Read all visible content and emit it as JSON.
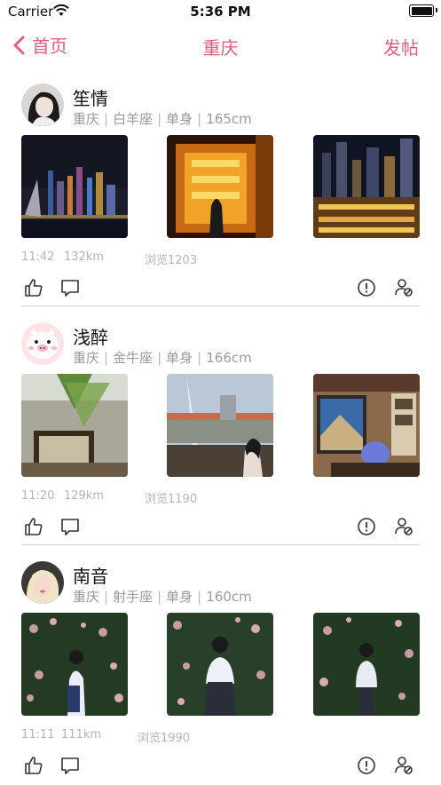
{
  "status_bar": {
    "carrier": "Carrier",
    "time": "5:36 PM"
  },
  "nav": {
    "back_label": "首页",
    "title": "重庆",
    "post_label": "发帖"
  },
  "posts": [
    {
      "name": "笙情",
      "info": [
        "重庆",
        "白羊座",
        "单身",
        "165cm"
      ],
      "time": "11:42",
      "distance": "132km",
      "views": "浏览1203"
    },
    {
      "name": "浅醉",
      "info": [
        "重庆",
        "金牛座",
        "单身",
        "166cm"
      ],
      "time": "11:20",
      "distance": "129km",
      "views": "浏览1190"
    },
    {
      "name": "南音",
      "info": [
        "重庆",
        "射手座",
        "单身",
        "160cm"
      ],
      "time": "11:11",
      "distance": "111km",
      "views": "浏览1990"
    }
  ],
  "colors": {
    "accent": "#e55d78",
    "meta_text": "#b5b5b5",
    "info_text": "#9a9a9a"
  },
  "icons": [
    "chevron-left-icon",
    "wifi-icon",
    "battery-icon",
    "like-icon",
    "comment-icon",
    "report-icon",
    "block-user-icon"
  ]
}
